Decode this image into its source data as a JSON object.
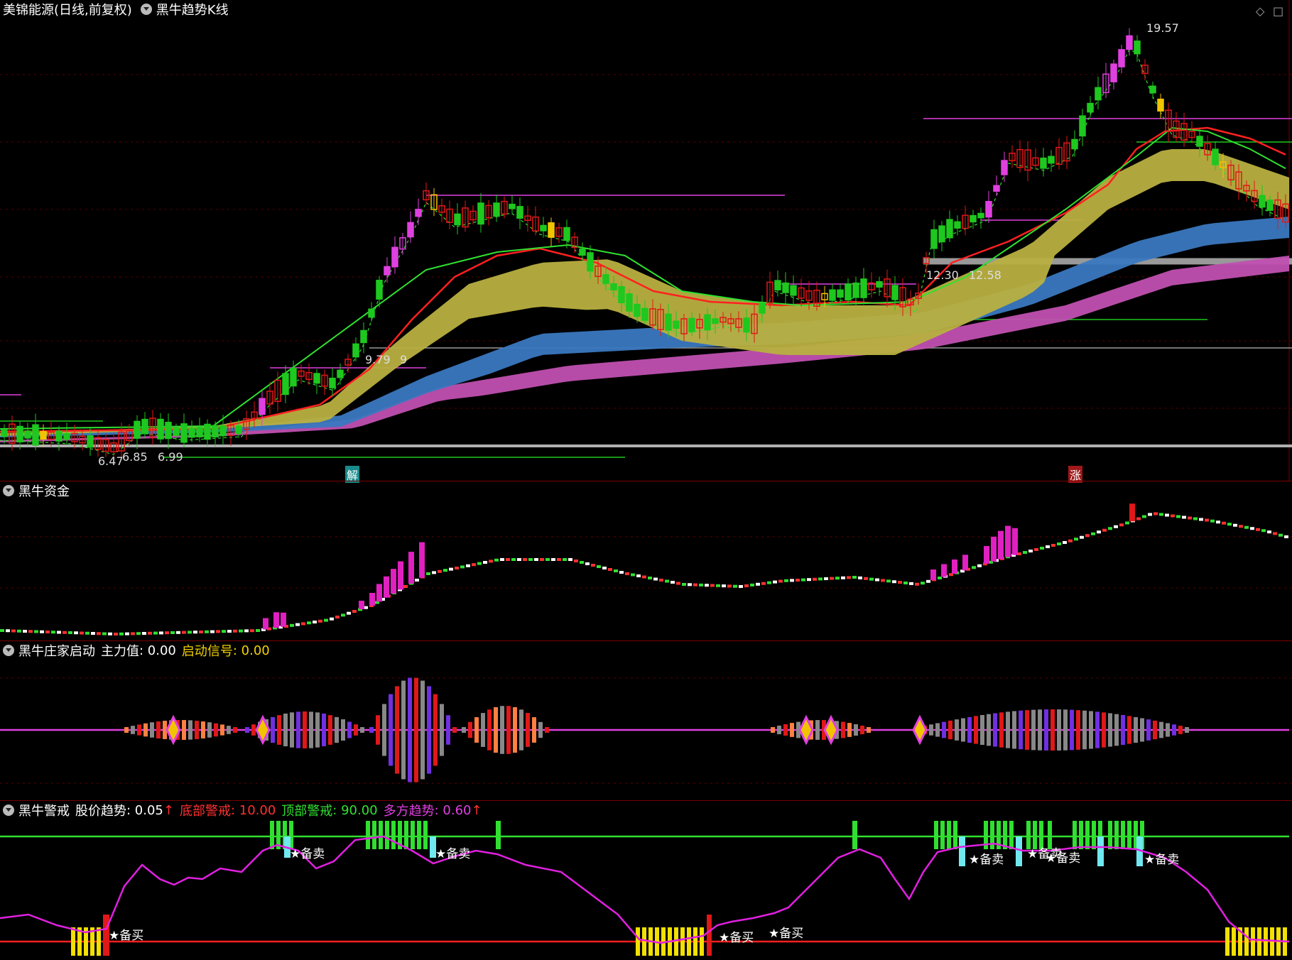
{
  "main_pane": {
    "stock_title": "美锦能源(日线,前复权)",
    "indicator_title": "黑牛趋势K线",
    "labels": {
      "high": "19.57",
      "low_a": "6.47",
      "low_b": "6.85",
      "low_c": "6.99",
      "mid_a": "9.79",
      "mid_a_tail": "9",
      "mid_b": "12.30",
      "mid_b_tail": "12.58",
      "signal_jie": "解",
      "signal_zhang": "涨"
    },
    "icons": [
      "diamond-icon",
      "window-icon"
    ]
  },
  "capital_pane": {
    "title": "黑牛资金"
  },
  "banker_pane": {
    "title": "黑牛庄家启动",
    "field1_label": "主力值",
    "field1_value": "0.00",
    "field2_label": "启动信号",
    "field2_value": "0.00"
  },
  "alert_pane": {
    "title": "黑牛警戒",
    "f1_label": "股价趋势",
    "f1_value": "0.05",
    "f2_label": "底部警戒",
    "f2_value": "10.00",
    "f3_label": "顶部警戒",
    "f3_value": "90.00",
    "f4_label": "多方趋势",
    "f4_value": "0.60",
    "buy_label": "★备买",
    "sell_label": "★备卖"
  },
  "colors": {
    "up": "#e01818",
    "down": "#1ec81e",
    "magenta": "#e040e0",
    "yellow": "#f2c400",
    "band_olive": "#b8b040",
    "band_blue": "#3a78c0",
    "band_pink": "#c050b0",
    "cyan": "#70e8f0"
  }
}
